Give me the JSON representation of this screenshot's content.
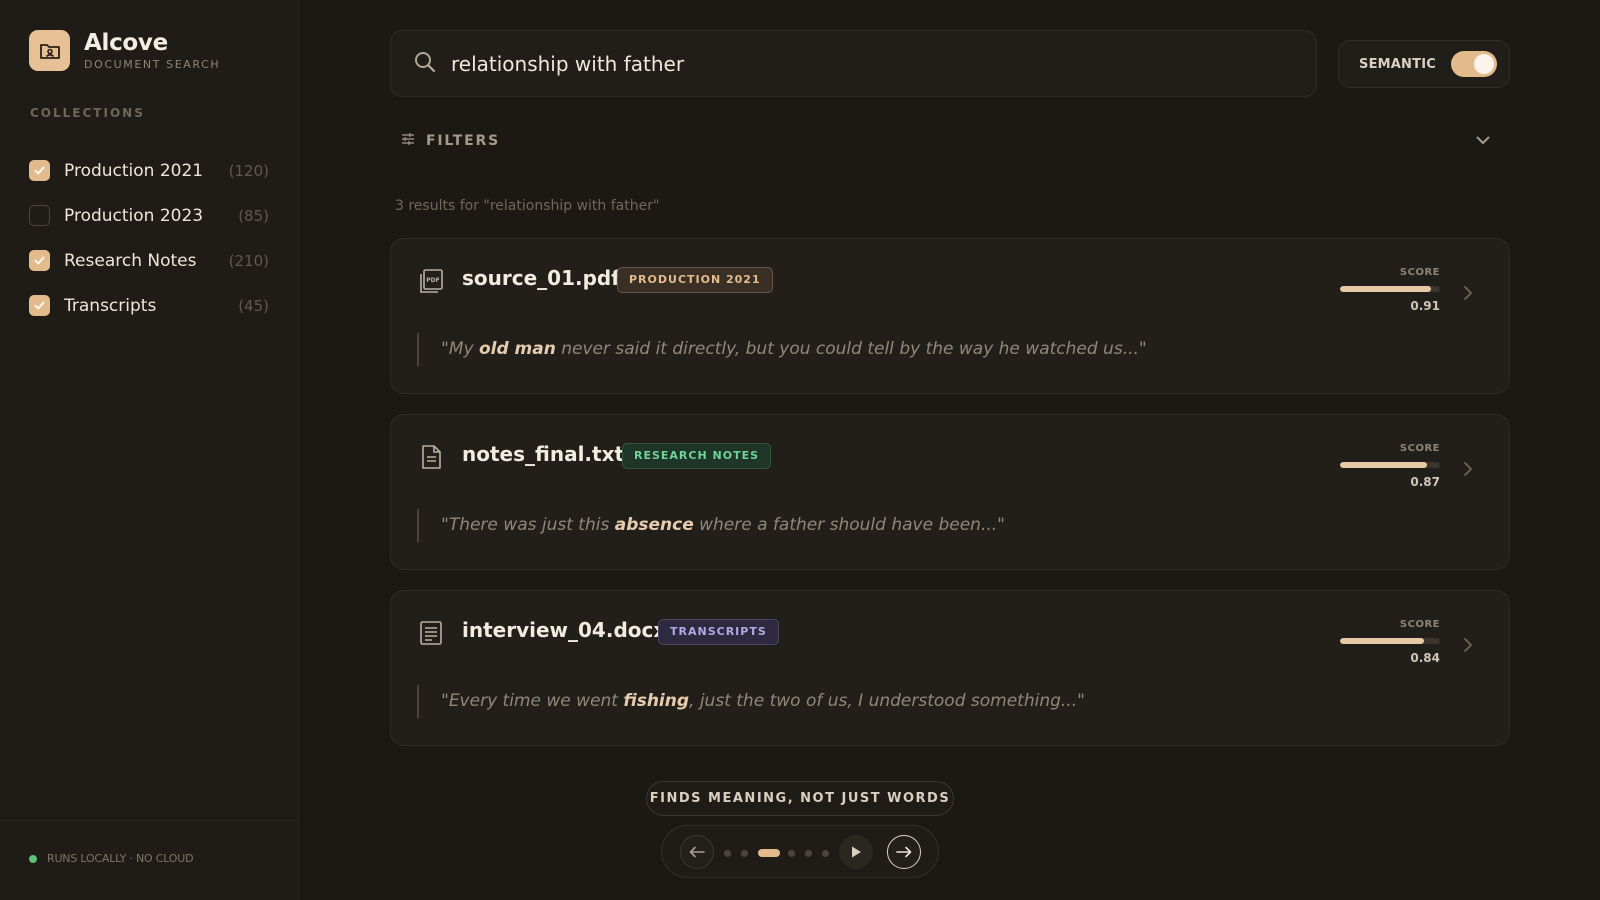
{
  "app": {
    "name": "Alcove",
    "subtitle": "DOCUMENT SEARCH",
    "logo_icon": "folder-user-icon"
  },
  "sidebar": {
    "section_title": "COLLECTIONS",
    "collections": [
      {
        "label": "Production 2021",
        "count": "(120)",
        "checked": true
      },
      {
        "label": "Production 2023",
        "count": "(85)",
        "checked": false
      },
      {
        "label": "Research Notes",
        "count": "(210)",
        "checked": true
      },
      {
        "label": "Transcripts",
        "count": "(45)",
        "checked": true
      }
    ],
    "footer": "RUNS LOCALLY · NO CLOUD"
  },
  "search": {
    "query": "relationship with father",
    "semantic_label": "SEMANTIC",
    "semantic_on": true
  },
  "filters": {
    "label": "FILTERS"
  },
  "results": {
    "summary": "3 results for \"relationship with father\"",
    "score_label": "SCORE",
    "items": [
      {
        "filename": "source_01.pdf",
        "file_icon": "pdf-file-icon",
        "tag": "PRODUCTION 2021",
        "tag_color": "#e3bb8d",
        "score": "0.91",
        "quote_before": "\"My ",
        "quote_highlight": "old man",
        "quote_after": " never said it directly, but you could tell by the way he watched us...\""
      },
      {
        "filename": "notes_final.txt",
        "file_icon": "text-file-icon",
        "tag": "RESEARCH NOTES",
        "tag_color": "#6fd39a",
        "score": "0.87",
        "quote_before": "\"There was just this ",
        "quote_highlight": "absence",
        "quote_after": " where a father should have been...\""
      },
      {
        "filename": "interview_04.docx",
        "file_icon": "document-icon",
        "tag": "TRANSCRIPTS",
        "tag_color": "#b3a8e6",
        "score": "0.84",
        "quote_before": "\"Every time we went ",
        "quote_highlight": "fishing",
        "quote_after": ", just the two of us, I understood something...\""
      }
    ]
  },
  "footer_pill": "FINDS MEANING, NOT JUST WORDS",
  "pager": {
    "total_dots": 6,
    "active_index": 2
  },
  "colors": {
    "accent": "#e3ba8c",
    "background": "#1c1915",
    "status_green": "#5bc27a"
  }
}
